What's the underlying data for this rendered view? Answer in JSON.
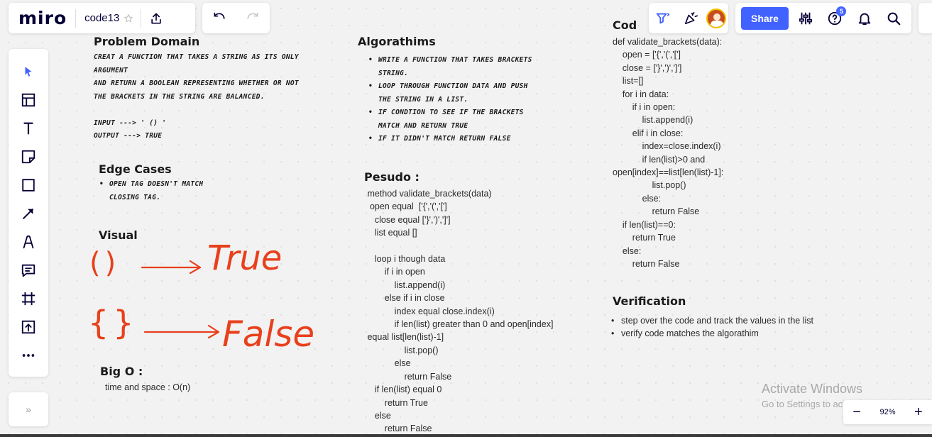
{
  "app": {
    "logo": "miro",
    "board_name": "code13",
    "share_label": "Share",
    "notification_count": "5",
    "zoom": "92%",
    "expand_label": "»"
  },
  "left_tools": [
    "select",
    "templates",
    "text",
    "sticky-note",
    "shape",
    "connection-line",
    "pen",
    "comment",
    "frame",
    "upload",
    "more"
  ],
  "board": {
    "problem": {
      "title": "Problem Domain",
      "lines": [
        "creat a function that takes a string as its only",
        "argument",
        "and return a Boolean representing whether or not",
        "the brackets in the string are balanced.",
        "",
        "INPUT ---> ' () '",
        "OUTPUT ---> True"
      ]
    },
    "edge": {
      "title": "Edge Cases",
      "items": [
        "open tag doesn't match closing tag."
      ]
    },
    "visual": {
      "title": "Visual",
      "row1_symbol": "()",
      "row1_result": "True",
      "row2_symbol": "{}",
      "row2_result": "False"
    },
    "bigo": {
      "title": "Big O :",
      "text": "time and space : O(n)"
    },
    "algorithms": {
      "title": "Algorathims",
      "items": [
        "write a function that takes brackets string.",
        "loop through function data and push the string in a list.",
        "if condtion to see if the brackets match and return True",
        "if it didn't match return False"
      ]
    },
    "pseudo": {
      "title": "Pesudo :",
      "code": " method validate_brackets(data)\n  open equal  ['{','(','[']\n    close equal ['}',')',']']\n    list equal []\n\n    loop i though data\n        if i in open\n            list.append(i)\n        else if i in close\n            index equal close.index(i)\n            if len(list) greater than 0 and open[index]\n equal list[len(list)-1]\n                list.pop()\n            else\n                return False\n    if len(list) equal 0\n        return True\n    else\n        return False"
    },
    "code": {
      "title": "Cod",
      "code": "def validate_brackets(data):\n    open = ['{','(','[']\n    close = ['}',')',']']\n    list=[]\n    for i in data:\n        if i in open:\n            list.append(i)\n        elif i in close:\n            index=close.index(i)\n            if len(list)>0 and\nopen[index]==list[len(list)-1]:\n                list.pop()\n            else:\n                return False\n    if len(list)==0:\n        return True\n    else:\n        return False"
    },
    "verification": {
      "title": "Verification",
      "items": [
        "step over the code and track the values in the list",
        "verify code matches the algorathim"
      ]
    }
  },
  "watermark": {
    "title": "Activate Windows",
    "subtitle": "Go to Settings to activate Windows."
  },
  "colors": {
    "accent": "#4262ff",
    "sketch": "#e8401c",
    "logo": "#050038"
  }
}
